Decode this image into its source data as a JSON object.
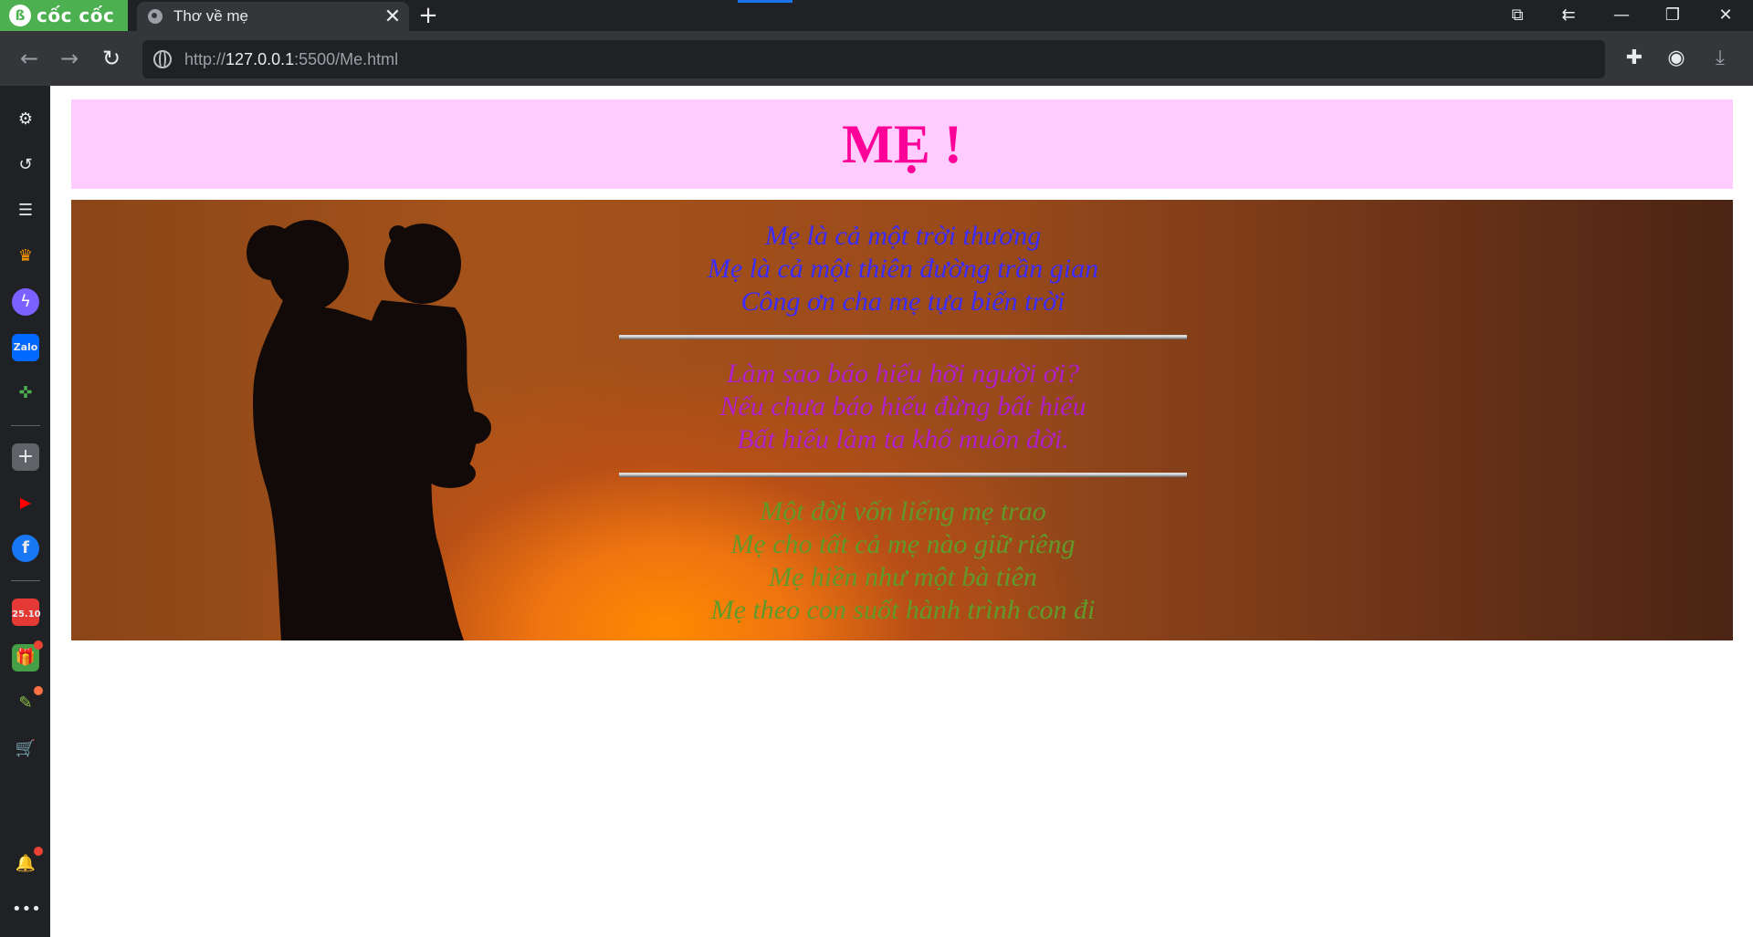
{
  "browser": {
    "brand": "cốc cốc",
    "tab": {
      "title": "Thơ về mẹ"
    },
    "new_tab": "+",
    "url": {
      "scheme": "http://",
      "host": "127.0.0.1",
      "rest": ":5500/Me.html"
    }
  },
  "page": {
    "title": "MẸ !",
    "stanzas": [
      {
        "lines": [
          "Mẹ là cả một trời thương",
          "Mẹ là cả một thiên đường trần gian",
          "Công ơn cha mẹ tựa biển trời"
        ]
      },
      {
        "lines": [
          "Làm sao báo hiếu hỡi người ơi?",
          "Nếu chưa báo hiếu đừng bất hiếu",
          "Bất hiếu làm ta khổ muôn đời."
        ]
      },
      {
        "lines": [
          "Một đời vốn liếng mẹ trao",
          "Mẹ cho tất cả mẹ nào giữ riêng",
          "Mẹ hiền như một bà tiên",
          "Mẹ theo con suốt hành trình con đi"
        ]
      }
    ]
  },
  "sidebar": {
    "badges": {
      "calendar": "25.10"
    }
  },
  "colors": {
    "header_bg": "#ffccff",
    "title": "#ff0099",
    "stanza1": "#3b2bff",
    "stanza2": "#b020c8",
    "stanza3": "#5f9a2b",
    "brand_green": "#4caf50"
  }
}
